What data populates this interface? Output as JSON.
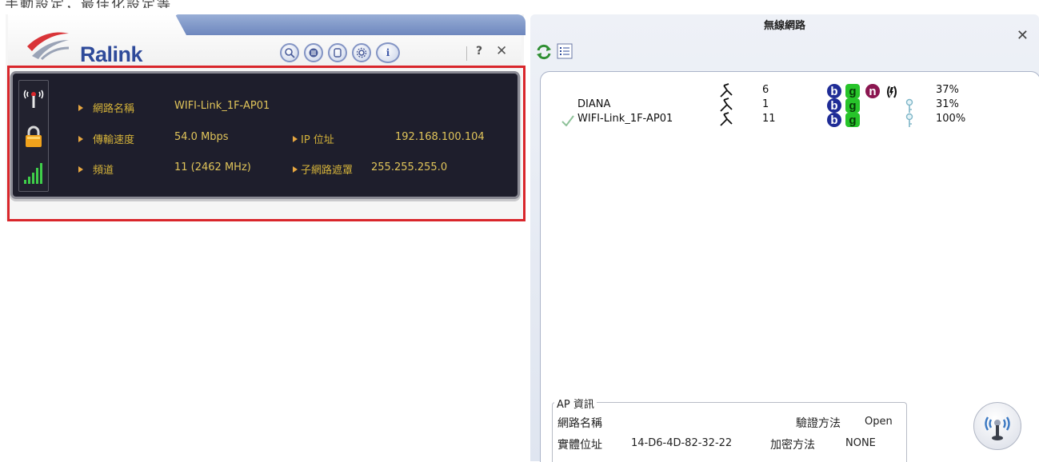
{
  "top_strip_text": "手動設定，最佳化設定等",
  "left_panel": {
    "brand": "Ralink",
    "toolbar": {
      "search_label": "search",
      "list_label": "list",
      "doc_label": "document",
      "settings_label": "settings",
      "info_label": "i",
      "help_label": "?",
      "close_label": "✕"
    },
    "status": {
      "ssid_label": "網路名稱",
      "ssid_value": "WIFI-Link_1F-AP01",
      "speed_label": "傳輸速度",
      "speed_value": "54.0 Mbps",
      "channel_label": "頻道",
      "channel_value": "11 (2462 MHz)",
      "ip_label": "IP 位址",
      "ip_value": "192.168.100.104",
      "mask_label": "子網路遮罩",
      "mask_value": "255.255.255.0"
    }
  },
  "right_panel": {
    "title": "無線網路",
    "close_label": "✕",
    "networks": [
      {
        "name": "",
        "channel": "6",
        "signal": "37%",
        "badges": [
          "b",
          "g",
          "n"
        ],
        "security": "wps",
        "connected": false
      },
      {
        "name": "DIANA",
        "channel": "1",
        "signal": "31%",
        "badges": [
          "b",
          "g"
        ],
        "security": "key",
        "connected": false
      },
      {
        "name": "WIFI-Link_1F-AP01",
        "channel": "11",
        "signal": "100%",
        "badges": [
          "b",
          "g"
        ],
        "security": "key",
        "connected": true
      }
    ],
    "ap_info": {
      "legend": "AP 資訊",
      "ssid_label": "網路名稱",
      "ssid_value": "",
      "mac_label": "實體位址",
      "mac_value": "14-D6-4D-82-32-22",
      "auth_label": "驗證方法",
      "auth_value": "Open",
      "enc_label": "加密方法",
      "enc_value": "NONE"
    }
  },
  "colors": {
    "red_frame": "#d9262b",
    "panel_bg": "#1e1e2c",
    "label_gold": "#d4b23a",
    "brand_blue": "#2e4a9a",
    "badge_b": "#1f2c96",
    "badge_g": "#27c42a",
    "badge_n": "#8b1650"
  }
}
